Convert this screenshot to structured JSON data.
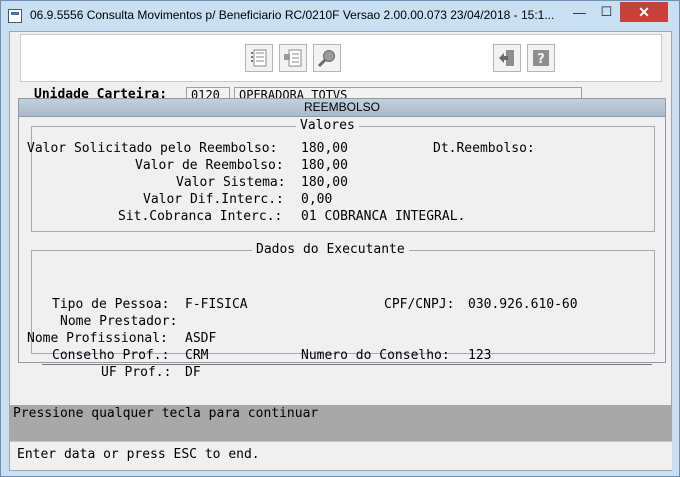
{
  "window": {
    "title": "06.9.5556 Consulta Movimentos p/ Beneficiario RC/0210F Versao 2.00.00.073 23/04/2018 - 15:1...",
    "minimize_glyph": "—",
    "maximize_glyph": "☐",
    "close_glyph": "✕"
  },
  "toolbar": {
    "buttons": [
      {
        "name": "list-icon"
      },
      {
        "name": "detail-list-icon"
      },
      {
        "name": "search-icon"
      },
      {
        "name": "exit-door-icon"
      },
      {
        "name": "help-icon"
      }
    ]
  },
  "header": {
    "unidade_label": "Unidade Carteira:",
    "unidade_code": "0120",
    "unidade_name": "OPERADORA TOTVS"
  },
  "dialog": {
    "title": "REEMBOLSO",
    "valores": {
      "legend": "Valores",
      "valor_solicitado_label": "Valor Solicitado pelo Reembolso:",
      "valor_solicitado": "180,00",
      "dt_reembolso_label": "Dt.Reembolso:",
      "valor_reembolso_label": "Valor de Reembolso:",
      "valor_reembolso": "180,00",
      "valor_sistema_label": "Valor Sistema:",
      "valor_sistema": "180,00",
      "valor_dif_label": "Valor Dif.Interc.:",
      "valor_dif": "0,00",
      "sit_cobranca_label": "Sit.Cobranca Interc.:",
      "sit_cobranca": "01 COBRANCA INTEGRAL."
    },
    "executante": {
      "legend": "Dados do Executante",
      "tipo_pessoa_label": "Tipo de Pessoa:",
      "tipo_pessoa": "F-FISICA",
      "cpf_label": "CPF/CNPJ:",
      "cpf": "030.926.610-60",
      "nome_prestador_label": "Nome Prestador:",
      "nome_profissional_label": "Nome Profissional:",
      "nome_profissional": "ASDF",
      "conselho_label": "Conselho Prof.:",
      "conselho": "CRM",
      "numero_conselho_label": "Numero do Conselho:",
      "numero_conselho": "123",
      "uf_label": "UF Prof.:",
      "uf": "DF"
    }
  },
  "message": "Pressione qualquer tecla para continuar",
  "status": "Enter data or press ESC to end."
}
